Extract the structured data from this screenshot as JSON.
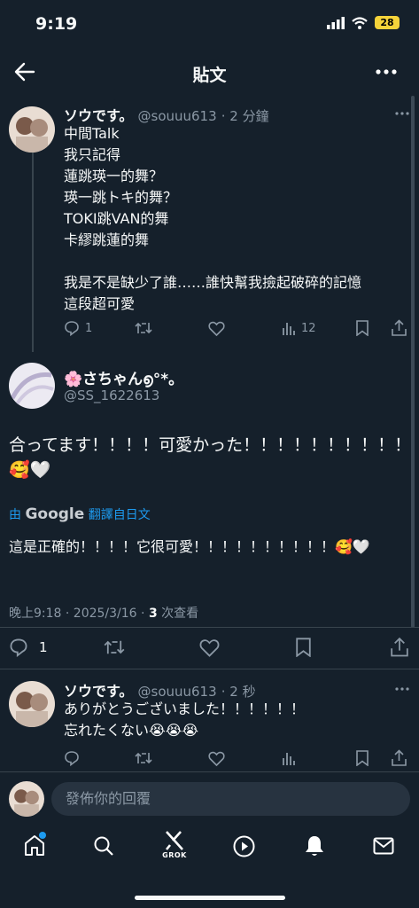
{
  "status_bar": {
    "time": "9:19",
    "battery": "28"
  },
  "header": {
    "title": "貼文"
  },
  "tweets": [
    {
      "name": "ソウです。",
      "handle": "@souuu613",
      "time": "· 2 分鐘",
      "text": "中間Talk\n我只記得\n蓮跳瑛一的舞？\n瑛一跳トキ的舞？\nTOKI跳VAN的舞\n卡繆跳蓮的舞\n\n我是不是缺少了誰……誰快幫我撿起破碎的記憶\n這段超可愛",
      "replies": "1",
      "views": "12"
    }
  ],
  "main_tweet": {
    "name": "🌸さちゃん൭°*。",
    "handle": "@SS_1622613",
    "text": "合ってます！！！！可愛かった！！！！！！！！！！🥰🤍",
    "translate_by": "由",
    "google": "Google",
    "translate_link": "翻譯自日文",
    "translation": "這是正確的！！！！它很可愛！！！！！！！！！！🥰🤍",
    "meta_time": "晚上9:18 · 2025/3/16 · ",
    "views_count": "3",
    "views_label": " 次查看",
    "replies": "1"
  },
  "reply_tweet": {
    "name": "ソウです。",
    "handle": "@souuu613",
    "time": "· 2 秒",
    "text": "ありがとうございました！！！！！！\n忘れたくない😭😭😭"
  },
  "reply_box": {
    "placeholder": "發佈你的回覆"
  },
  "tabbar": {
    "grok_label": "GROK"
  }
}
